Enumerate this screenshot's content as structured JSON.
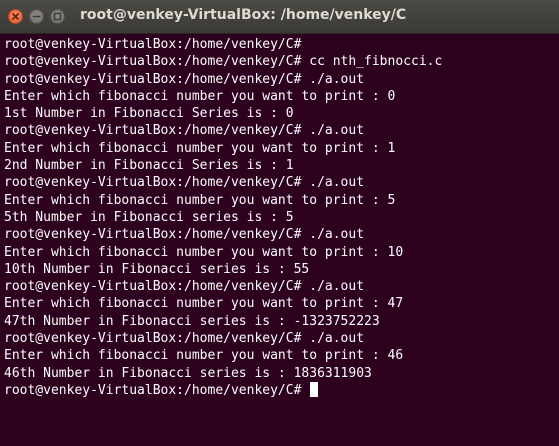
{
  "window": {
    "title": "root@venkey-VirtualBox: /home/venkey/C"
  },
  "titlebar_icons": [
    "close-icon",
    "minimize-icon",
    "maximize-icon"
  ],
  "colors": {
    "terminal_background": "#2c001e",
    "terminal_text": "#ffffff",
    "close_button": "#e8622f",
    "titlebar": "#3f3e3a"
  },
  "terminal": {
    "lines": [
      "root@venkey-VirtualBox:/home/venkey/C#",
      "root@venkey-VirtualBox:/home/venkey/C# cc nth_fibnocci.c",
      "root@venkey-VirtualBox:/home/venkey/C# ./a.out",
      "Enter which fibonacci number you want to print : 0",
      "1st Number in Fibonacci Series is : 0",
      "root@venkey-VirtualBox:/home/venkey/C# ./a.out",
      "Enter which fibonacci number you want to print : 1",
      "2nd Number in Fibonacci Series is : 1",
      "root@venkey-VirtualBox:/home/venkey/C# ./a.out",
      "Enter which fibonacci number you want to print : 5",
      "5th Number in Fibonacci series is : 5",
      "root@venkey-VirtualBox:/home/venkey/C# ./a.out",
      "Enter which fibonacci number you want to print : 10",
      "10th Number in Fibonacci series is : 55",
      "root@venkey-VirtualBox:/home/venkey/C# ./a.out",
      "Enter which fibonacci number you want to print : 47",
      "47th Number in Fibonacci series is : -1323752223",
      "root@venkey-VirtualBox:/home/venkey/C# ./a.out",
      "Enter which fibonacci number you want to print : 46",
      "46th Number in Fibonacci series is : 1836311903"
    ],
    "prompt": "root@venkey-VirtualBox:/home/venkey/C# "
  }
}
